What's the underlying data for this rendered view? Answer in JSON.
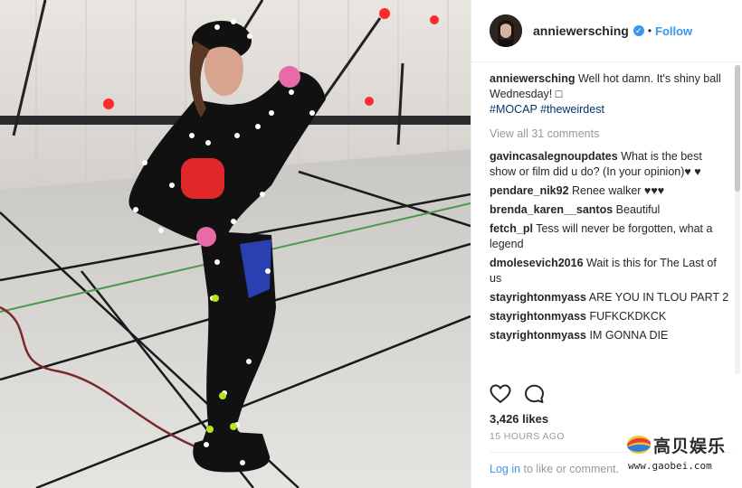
{
  "post": {
    "image_alt": "Photo",
    "username": "anniewersching",
    "verified_mark": "✓",
    "separator": "•",
    "follow_label": "Follow",
    "caption_text": "Well hot damn. It's shiny ball Wednesday! □",
    "hashtags": [
      "#MOCAP",
      "#theweirdest"
    ],
    "view_all_label": "View all 31 comments",
    "comments": [
      {
        "user": "gavincasalegnoupdates",
        "text": "What is the best show or film did u do? (In your opinion)♥ ♥"
      },
      {
        "user": "pendare_nik92",
        "text": "Renee walker ♥♥♥"
      },
      {
        "user": "brenda_karen__santos",
        "text": "Beautiful"
      },
      {
        "user": "fetch_pl",
        "text": "Tess will never be forgotten, what a legend"
      },
      {
        "user": "dmolesevich2016",
        "text": "Wait is this for The Last of us"
      },
      {
        "user": "stayrightonmyass",
        "text": "ARE YOU IN TLOU PART 2"
      },
      {
        "user": "stayrightonmyass",
        "text": "FUFKCKDKCK"
      },
      {
        "user": "stayrightonmyass",
        "text": "IM GONNA DIE"
      }
    ],
    "likes": "3,426 likes",
    "timestamp": "15 HOURS AGO",
    "login_link": "Log in",
    "login_suffix": " to like or comment."
  },
  "icons": {
    "like": "heart-outline-icon",
    "comment": "comment-bubble-icon"
  },
  "watermark": {
    "brand_cn": "高贝娱乐",
    "url": "www.gaobei.com"
  },
  "colors": {
    "link_blue": "#3897f0",
    "hashtag_blue": "#003569",
    "muted": "#999999",
    "text": "#262626"
  }
}
